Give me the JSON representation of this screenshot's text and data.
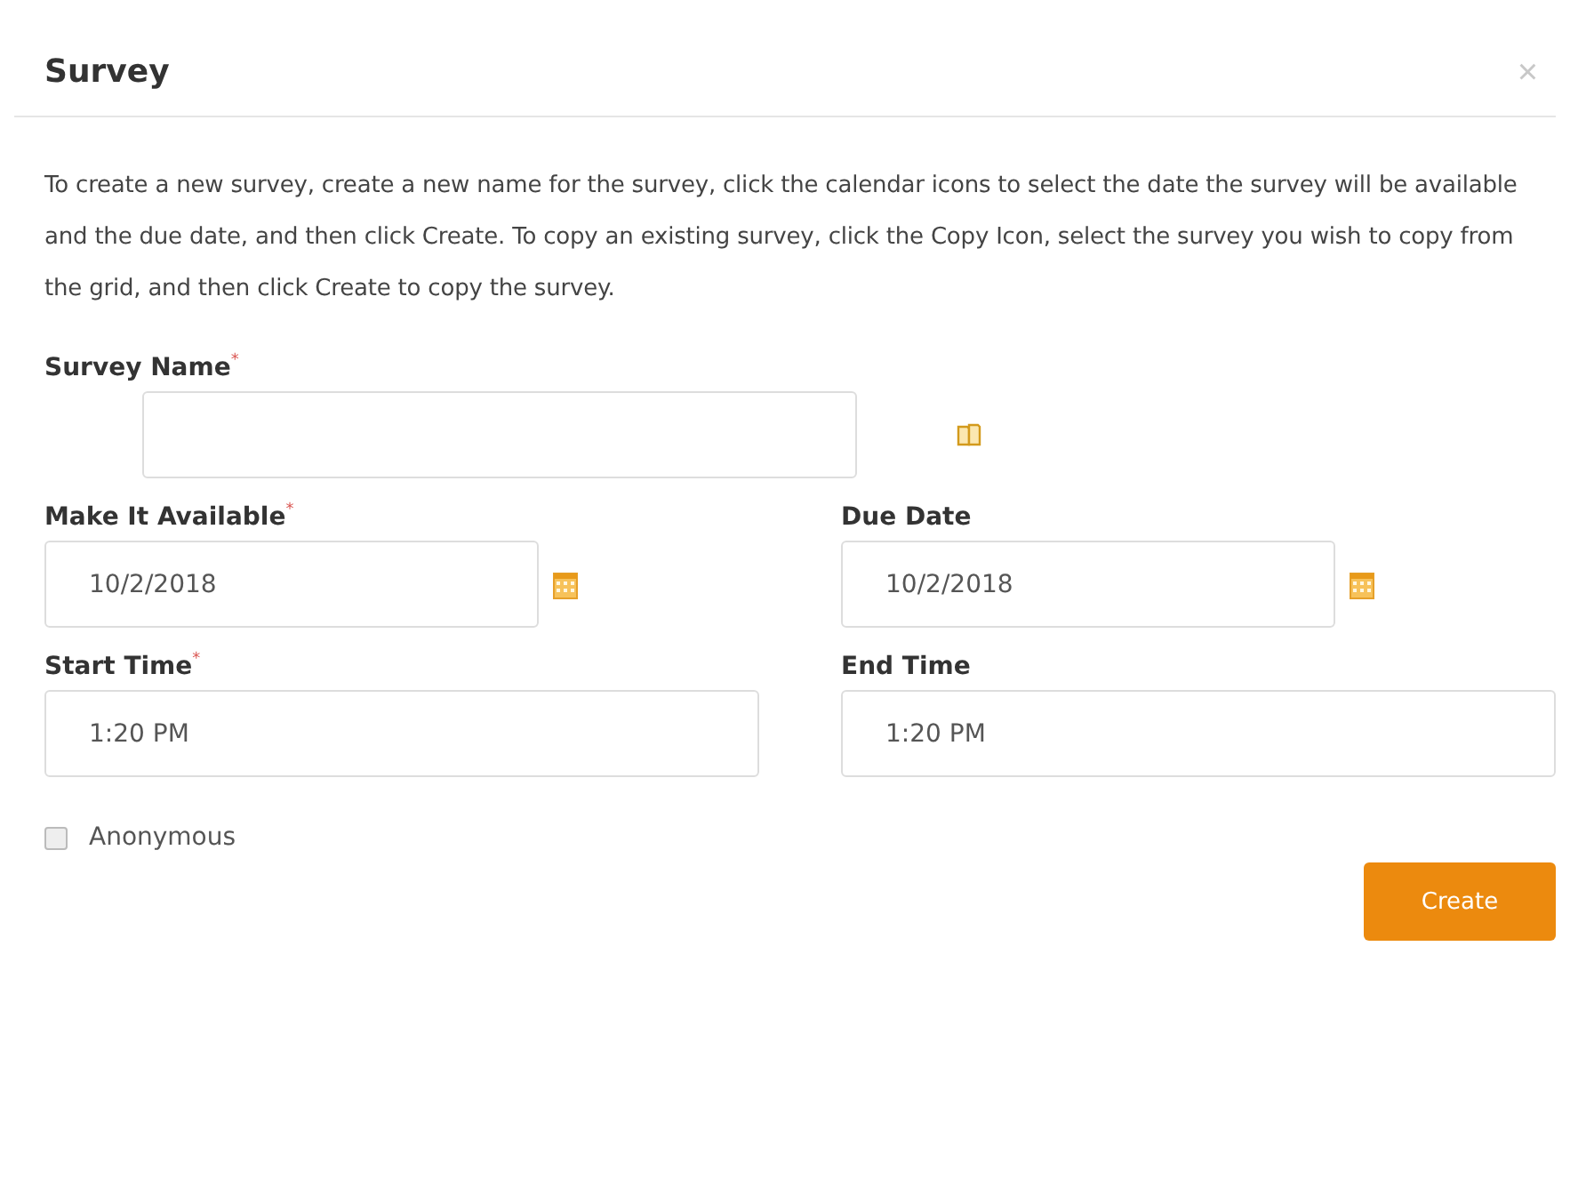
{
  "dialog": {
    "title": "Survey",
    "close": "×"
  },
  "instructions": "To create a new survey, create a new name for the survey, click the calendar icons to select the date the survey will be available and the due date, and then click Create. To copy an existing survey, click the Copy Icon, select the survey you wish to copy from the grid, and then click Create to copy the survey.",
  "rows": [
    [
      {
        "label": "Survey Name",
        "required_mark": "*",
        "kind": "copy"
      }
    ],
    [
      {
        "label": "Make It Available",
        "required_mark": "*",
        "value": "10/2/2018",
        "kind": "date"
      },
      {
        "label": "Due Date",
        "value": "10/2/2018",
        "kind": "date"
      }
    ],
    [
      {
        "label": "Start Time",
        "required_mark": "*",
        "value": "1:20 PM",
        "kind": "time"
      },
      {
        "label": "End Time",
        "value": "1:20 PM",
        "kind": "time"
      }
    ]
  ],
  "anonymous": {
    "label": "Anonymous",
    "checked": false
  },
  "buttons": [
    {
      "label": "Create"
    }
  ]
}
